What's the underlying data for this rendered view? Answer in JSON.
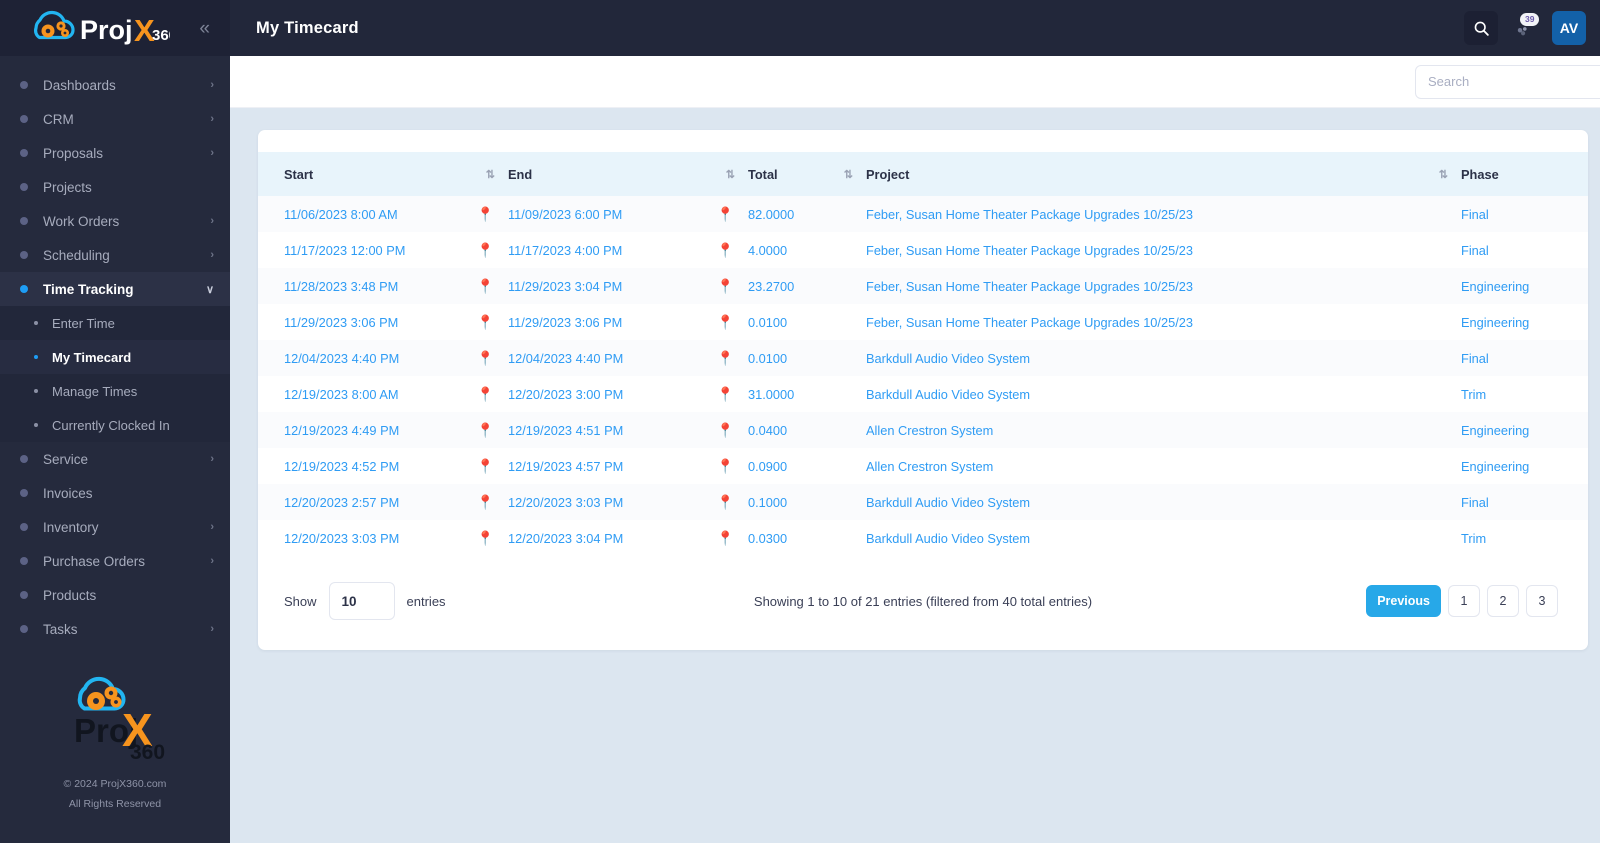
{
  "brand": {
    "name": "ProjX360",
    "collapse_icon": "chevrons-left-icon"
  },
  "sidebar": {
    "items": [
      {
        "label": "Dashboards",
        "chevron": "›",
        "expandable": true
      },
      {
        "label": "CRM",
        "chevron": "›",
        "expandable": true
      },
      {
        "label": "Proposals",
        "chevron": "›",
        "expandable": true
      },
      {
        "label": "Projects",
        "chevron": "",
        "expandable": false
      },
      {
        "label": "Work Orders",
        "chevron": "›",
        "expandable": true
      },
      {
        "label": "Scheduling",
        "chevron": "›",
        "expandable": true
      },
      {
        "label": "Time Tracking",
        "chevron": "∨",
        "expandable": true,
        "active": true
      },
      {
        "label": "Service",
        "chevron": "›",
        "expandable": true
      },
      {
        "label": "Invoices",
        "chevron": "",
        "expandable": false
      },
      {
        "label": "Inventory",
        "chevron": "›",
        "expandable": true
      },
      {
        "label": "Purchase Orders",
        "chevron": "›",
        "expandable": true
      },
      {
        "label": "Products",
        "chevron": "",
        "expandable": false
      },
      {
        "label": "Tasks",
        "chevron": "›",
        "expandable": true
      }
    ],
    "time_tracking_sub": [
      {
        "label": "Enter Time",
        "active": false
      },
      {
        "label": "My Timecard",
        "active": true
      },
      {
        "label": "Manage Times",
        "active": false
      },
      {
        "label": "Currently Clocked In",
        "active": false
      }
    ],
    "footer": {
      "copyright": "© 2024 ProjX360.com",
      "rights": "All Rights Reserved"
    }
  },
  "header": {
    "title": "My Timecard",
    "search_icon": "search-icon",
    "notifications_icon": "bell-icon",
    "notification_count": "39",
    "avatar_initials": "AV"
  },
  "search": {
    "placeholder": "Search",
    "value": ""
  },
  "table": {
    "columns": [
      {
        "label": "Start",
        "sortable": true
      },
      {
        "label": "End",
        "sortable": true
      },
      {
        "label": "Total",
        "sortable": true
      },
      {
        "label": "Project",
        "sortable": true
      },
      {
        "label": "Phase",
        "sortable": false
      }
    ],
    "rows": [
      {
        "start": "11/06/2023 8:00 AM",
        "end": "11/09/2023 6:00 PM",
        "total": "82.0000",
        "project": "Feber, Susan Home Theater Package Upgrades 10/25/23",
        "phase": "Final"
      },
      {
        "start": "11/17/2023 12:00 PM",
        "end": "11/17/2023 4:00 PM",
        "total": "4.0000",
        "project": "Feber, Susan Home Theater Package Upgrades 10/25/23",
        "phase": "Final"
      },
      {
        "start": "11/28/2023 3:48 PM",
        "end": "11/29/2023 3:04 PM",
        "total": "23.2700",
        "project": "Feber, Susan Home Theater Package Upgrades 10/25/23",
        "phase": "Engineering"
      },
      {
        "start": "11/29/2023 3:06 PM",
        "end": "11/29/2023 3:06 PM",
        "total": "0.0100",
        "project": "Feber, Susan Home Theater Package Upgrades 10/25/23",
        "phase": "Engineering"
      },
      {
        "start": "12/04/2023 4:40 PM",
        "end": "12/04/2023 4:40 PM",
        "total": "0.0100",
        "project": "Barkdull Audio Video System",
        "phase": "Final"
      },
      {
        "start": "12/19/2023 8:00 AM",
        "end": "12/20/2023 3:00 PM",
        "total": "31.0000",
        "project": "Barkdull Audio Video System",
        "phase": "Trim"
      },
      {
        "start": "12/19/2023 4:49 PM",
        "end": "12/19/2023 4:51 PM",
        "total": "0.0400",
        "project": "Allen Crestron System",
        "phase": "Engineering"
      },
      {
        "start": "12/19/2023 4:52 PM",
        "end": "12/19/2023 4:57 PM",
        "total": "0.0900",
        "project": "Allen Crestron System",
        "phase": "Engineering"
      },
      {
        "start": "12/20/2023 2:57 PM",
        "end": "12/20/2023 3:03 PM",
        "total": "0.1000",
        "project": "Barkdull Audio Video System",
        "phase": "Final"
      },
      {
        "start": "12/20/2023 3:03 PM",
        "end": "12/20/2023 3:04 PM",
        "total": "0.0300",
        "project": "Barkdull Audio Video System",
        "phase": "Trim"
      }
    ],
    "location_pin_icon": "map-pin-icon",
    "sort_icon": "sort-updown-icon"
  },
  "footer": {
    "show_label": "Show",
    "page_length": "10",
    "entries_label": "entries",
    "info": "Showing 1 to 10 of 21 entries (filtered from 40 total entries)",
    "pagination": [
      {
        "label": "Previous",
        "active": true
      },
      {
        "label": "1",
        "active": false
      },
      {
        "label": "2",
        "active": false
      },
      {
        "label": "3",
        "active": false
      }
    ]
  },
  "colors": {
    "sidebar_bg": "#252a3d",
    "topbar_bg": "#22273a",
    "accent_blue": "#2f9cf4",
    "primary_button": "#27a8e8",
    "pin_red": "#ee1c23",
    "page_bg": "#dce6f0",
    "table_header_bg": "#e8f4fb",
    "avatar_bg": "#1361a8"
  }
}
